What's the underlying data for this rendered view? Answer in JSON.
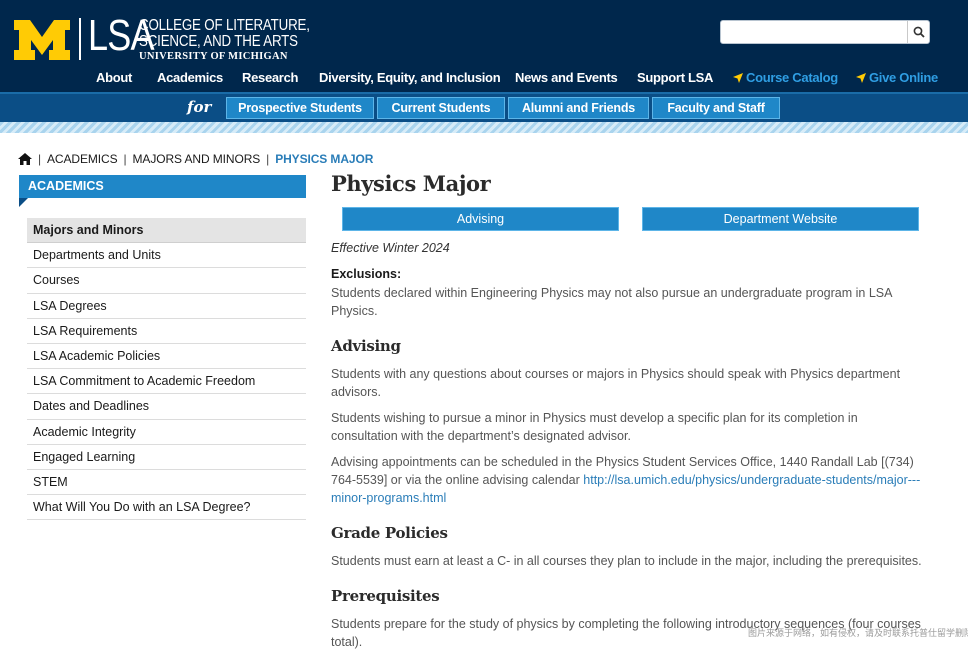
{
  "header": {
    "logo_letters": "LSA",
    "college_line1": "COLLEGE OF LITERATURE,",
    "college_line2": "SCIENCE, AND THE ARTS",
    "university": "UNIVERSITY OF MICHIGAN",
    "search_placeholder": "",
    "nav": [
      "About",
      "Academics",
      "Research",
      "Diversity, Equity, and Inclusion",
      "News and Events",
      "Support LSA"
    ],
    "nav_special": [
      "Course Catalog",
      "Give Online"
    ],
    "for_label": "for",
    "audience": [
      "Prospective Students",
      "Current Students",
      "Alumni and Friends",
      "Faculty and Staff"
    ],
    "colors": {
      "navy": "#00274c",
      "maize": "#ffcb05",
      "accent_blue": "#1f87c8"
    }
  },
  "breadcrumb": [
    "ACADEMICS",
    "MAJORS AND MINORS",
    "PHYSICS MAJOR"
  ],
  "sidebar": {
    "heading": "ACADEMICS",
    "items": [
      "Majors and Minors",
      "Departments and Units",
      "Courses",
      "LSA Degrees",
      "LSA Requirements",
      "LSA Academic Policies",
      "LSA Commitment to Academic Freedom",
      "Dates and Deadlines",
      "Academic Integrity",
      "Engaged Learning",
      "STEM",
      "What Will You Do with an LSA Degree?"
    ],
    "active_index": 0
  },
  "main": {
    "title": "Physics Major",
    "buttons": [
      "Advising",
      "Department Website"
    ],
    "effective": "Effective Winter 2024",
    "exclusions_label": "Exclusions:",
    "exclusions_l1": "Students declared within Engineering Physics may not also pursue an undergraduate program in LSA",
    "exclusions_l2": "Physics.",
    "advising_heading": "Advising",
    "adv_p1_l1": "Students with any questions about courses or majors in Physics should speak with Physics department",
    "adv_p1_l2": "advisors.",
    "adv_p2_l1": "Students wishing to pursue a minor in Physics must develop a specific plan for its completion in",
    "adv_p2_l2": "consultation with the department’s designated advisor.",
    "adv_p3_l1": "Advising appointments can be scheduled in the Physics Student Services Office, 1440 Randall Lab [(734)",
    "adv_p3_l2_text": "764-5539] or via the online advising calendar ",
    "adv_p3_l2_link": "http://lsa.umich.edu/physics/undergraduate-students/major---",
    "adv_p3_l3_link": "minor-programs.html",
    "grade_heading": "Grade Policies",
    "grade_p1": "Students must earn at least a C- in all courses they plan to include in the major, including the prerequisites.",
    "prereq_heading": "Prerequisites",
    "prereq_p1_l1": "Students prepare for the study of physics by completing the following introductory sequences (four courses",
    "prereq_p1_l2": "total)."
  },
  "watermark": "图片来源于网络，如有侵权，请及时联系托普仕留学删除"
}
